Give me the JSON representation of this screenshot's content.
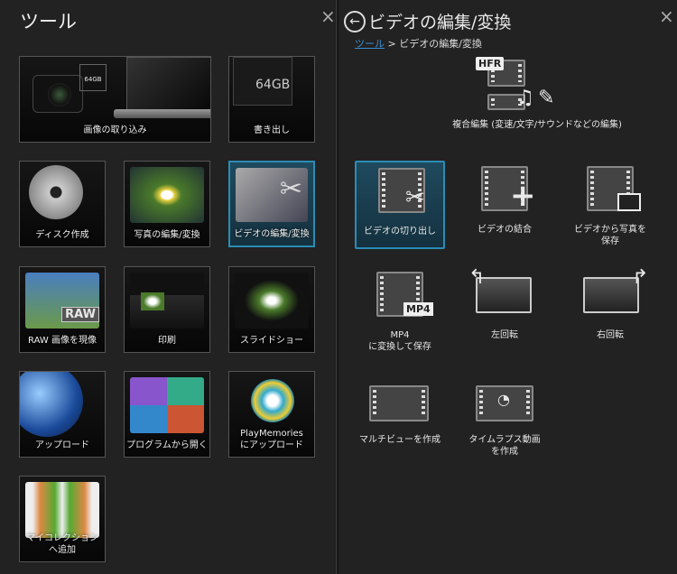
{
  "left": {
    "title": "ツール",
    "close": "×",
    "tiles": [
      {
        "label": "画像の取り込み",
        "card": "64GB"
      },
      {
        "label": "書き出し",
        "card": "64GB"
      },
      {
        "label": "ディスク作成"
      },
      {
        "label": "写真の編集/変換"
      },
      {
        "label": "ビデオの編集/変換"
      },
      {
        "label": "RAW 画像を現像",
        "badge": "RAW"
      },
      {
        "label": "印刷"
      },
      {
        "label": "スライドショー"
      },
      {
        "label": "アップロード"
      },
      {
        "label": "プログラムから開く"
      },
      {
        "label": "PlayMemories\nにアップロード"
      },
      {
        "label": "マイコレクション\nへ追加"
      }
    ]
  },
  "right": {
    "title": "ビデオの編集/変換",
    "close": "×",
    "breadcrumb": {
      "root": "ツール",
      "sep": ">",
      "current": "ビデオの編集/変換"
    },
    "composite": {
      "label": "複合編集 (変速/文字/サウンドなどの編集)",
      "badge": "HFR"
    },
    "actions": [
      {
        "label": "ビデオの切り出し"
      },
      {
        "label": "ビデオの結合"
      },
      {
        "label": "ビデオから写真を\n保存"
      },
      {
        "label": "MP4\nに変換して保存",
        "badge": "MP4"
      },
      {
        "label": "左回転"
      },
      {
        "label": "右回転"
      },
      {
        "label": "マルチビューを作成"
      },
      {
        "label": "タイムラプス動画\nを作成"
      }
    ]
  },
  "colors": {
    "accent": "#2a8db5",
    "link": "#3b8fd6"
  }
}
